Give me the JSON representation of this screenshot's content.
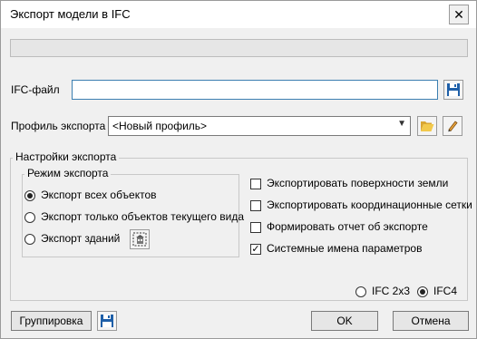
{
  "window": {
    "title": "Экспорт модели в IFC"
  },
  "ifc_file": {
    "label": "IFC-файл",
    "value": ""
  },
  "profile": {
    "label": "Профиль экспорта",
    "selected": "<Новый профиль>"
  },
  "settings": {
    "group_title": "Настройки экспорта",
    "mode_group_title": "Режим экспорта",
    "modes": [
      {
        "label": "Экспорт всех объектов",
        "selected": true
      },
      {
        "label": "Экспорт только объектов текущего вида",
        "selected": false
      },
      {
        "label": "Экспорт зданий",
        "selected": false
      }
    ],
    "options": [
      {
        "label": "Экспортировать поверхности земли",
        "checked": false
      },
      {
        "label": "Экспортировать координационные сетки",
        "checked": false
      },
      {
        "label": "Формировать отчет об экспорте",
        "checked": false
      },
      {
        "label": "Системные имена параметров",
        "checked": true
      }
    ],
    "versions": [
      {
        "label": "IFC 2x3",
        "selected": false
      },
      {
        "label": "IFC4",
        "selected": true
      }
    ]
  },
  "buttons": {
    "grouping": "Группировка",
    "ok": "OK",
    "cancel": "Отмена"
  },
  "icons": {
    "save": "floppy-disk-icon",
    "open": "folder-open-icon",
    "edit": "pencil-icon",
    "building_select": "building-select-icon",
    "close": "close-icon"
  },
  "colors": {
    "accent_border": "#3c7fb1",
    "floppy": "#1e5fa8"
  }
}
